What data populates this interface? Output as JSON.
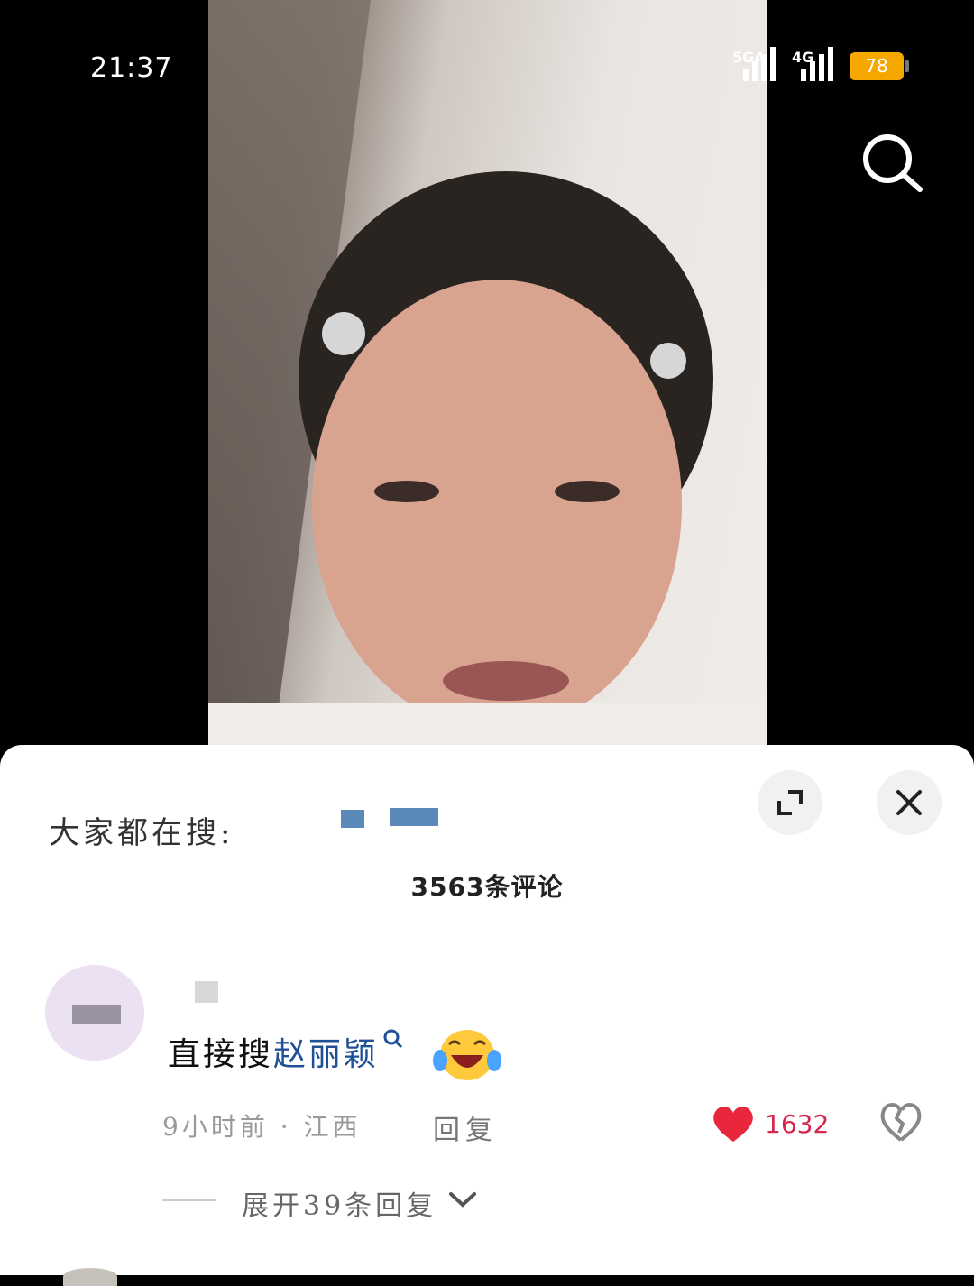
{
  "status_bar": {
    "time": "21:37",
    "network_1": "5GA",
    "network_2": "4G",
    "battery": "78"
  },
  "video": {
    "search_icon": "search-icon"
  },
  "comments_sheet": {
    "hot_search_label": "大家都在搜:",
    "comment_count": "3563条评论",
    "expand_icon": "expand-icon",
    "close_icon": "close-icon",
    "comment": {
      "text_prefix": "直接搜",
      "search_link": "赵丽颖",
      "emoji": "laughing-tears-emoji",
      "meta": "9小时前 · 江西",
      "reply_label": "回复",
      "like_count": "1632",
      "like_color": "#e8273d"
    },
    "expand_replies": "展开39条回复"
  }
}
